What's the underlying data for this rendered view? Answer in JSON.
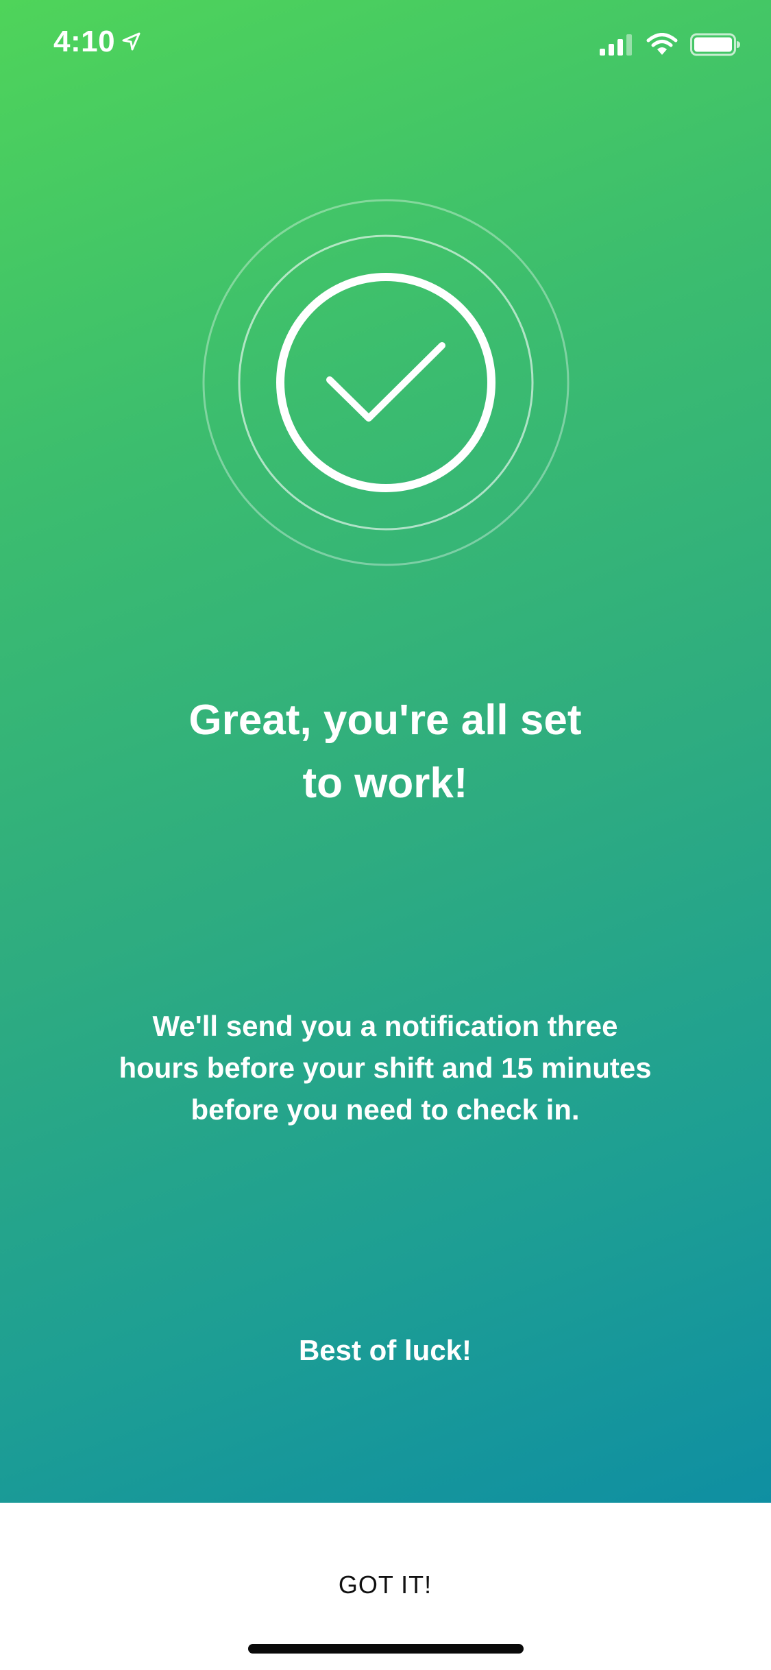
{
  "status_bar": {
    "time": "4:10",
    "icons": [
      "location-arrow-icon",
      "signal-bars-icon",
      "wifi-icon",
      "battery-icon"
    ]
  },
  "illustration": {
    "icon": "checkmark-circle-icon"
  },
  "content": {
    "headline_line1": "Great, you're all set",
    "headline_line2": "to work!",
    "body_line1": "We'll send you a notification three",
    "body_line2": "hours before your shift and 15 minutes",
    "body_line3": "before you need to check in.",
    "sign_off": "Best of luck!"
  },
  "footer": {
    "button_label": "GOT IT!"
  },
  "colors": {
    "gradient_start": "#4fd45a",
    "gradient_end": "#0f8fa2",
    "text": "#ffffff",
    "button_text": "#111111"
  }
}
